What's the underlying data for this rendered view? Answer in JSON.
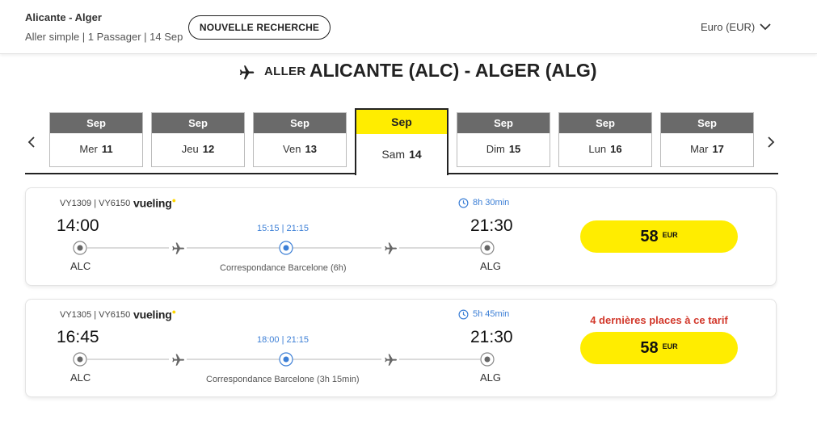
{
  "header": {
    "route": "Alicante - Alger",
    "summary": "Aller simple | 1 Passager | 14 Sep",
    "new_search_label": "NOUVELLE RECHERCHE",
    "currency": "Euro (EUR)"
  },
  "title": {
    "direction": "ALLER",
    "route": "ALICANTE (ALC) - ALGER (ALG)",
    "icon": "plane-icon"
  },
  "dates": [
    {
      "month": "Sep",
      "weekday": "Mer",
      "day": "11",
      "selected": false
    },
    {
      "month": "Sep",
      "weekday": "Jeu",
      "day": "12",
      "selected": false
    },
    {
      "month": "Sep",
      "weekday": "Ven",
      "day": "13",
      "selected": false
    },
    {
      "month": "Sep",
      "weekday": "Sam",
      "day": "14",
      "selected": true
    },
    {
      "month": "Sep",
      "weekday": "Dim",
      "day": "15",
      "selected": false
    },
    {
      "month": "Sep",
      "weekday": "Lun",
      "day": "16",
      "selected": false
    },
    {
      "month": "Sep",
      "weekday": "Mar",
      "day": "17",
      "selected": false
    }
  ],
  "flights": [
    {
      "numbers": "VY1309 | VY6150",
      "airline": "vueling",
      "duration": "8h 30min",
      "dep_time": "14:00",
      "arr_time": "21:30",
      "dep_airport": "ALC",
      "arr_airport": "ALG",
      "stop_times": "15:15 | 21:15",
      "connection": "Correspondance Barcelone (6h)",
      "price": "58",
      "currency": "EUR",
      "warning": ""
    },
    {
      "numbers": "VY1305 | VY6150",
      "airline": "vueling",
      "duration": "5h 45min",
      "dep_time": "16:45",
      "arr_time": "21:30",
      "dep_airport": "ALC",
      "arr_airport": "ALG",
      "stop_times": "18:00 | 21:15",
      "connection": "Correspondance Barcelone (3h 15min)",
      "price": "58",
      "currency": "EUR",
      "warning": "4 dernières places à ce tarif"
    }
  ],
  "colors": {
    "accent_yellow": "#ffed00",
    "link_blue": "#3c7fd6",
    "warning_red": "#d2382b",
    "month_bar": "#6a6a6a"
  }
}
